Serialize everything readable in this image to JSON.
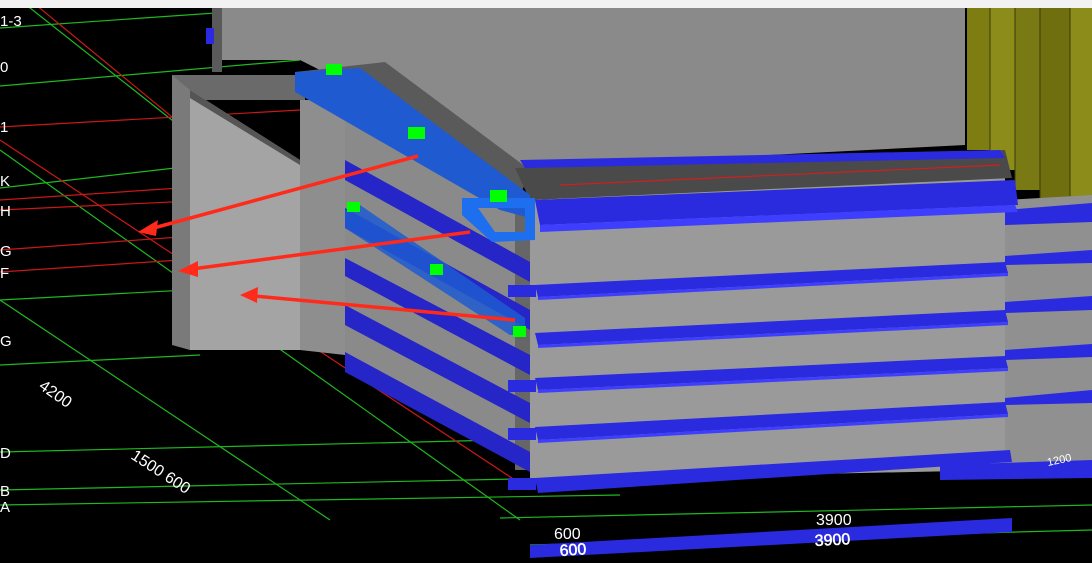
{
  "window": {
    "title": ""
  },
  "axis_labels": {
    "top_left": "1-3",
    "row_1": "0",
    "row_2": "1",
    "K": "K",
    "H": "H",
    "G1": "G",
    "F": "F",
    "G2": "G",
    "D": "D",
    "B": "B",
    "A": "A"
  },
  "dimensions": {
    "d_4200": "4200",
    "d_1500_600": "1500 600",
    "d_600": "600",
    "d_3900": "3900",
    "d_600_mirror": "600",
    "d_3900_mirror": "3900",
    "d_side": "1200"
  },
  "colors": {
    "background": "#000000",
    "concrete_face": "#8a8a8a",
    "concrete_dark": "#6e6e6e",
    "concrete_light": "#a8a8a8",
    "rebar_blue": "#2a2adf",
    "rebar_highlight": "#1f5ad0",
    "selection_blue": "#1e6ef0",
    "grip_green": "#00ff00",
    "grid_red": "#d21e1e",
    "grid_green": "#1fd21f",
    "arrow_red": "#ff2a1a",
    "yellow_column": "#8c8c1a"
  }
}
